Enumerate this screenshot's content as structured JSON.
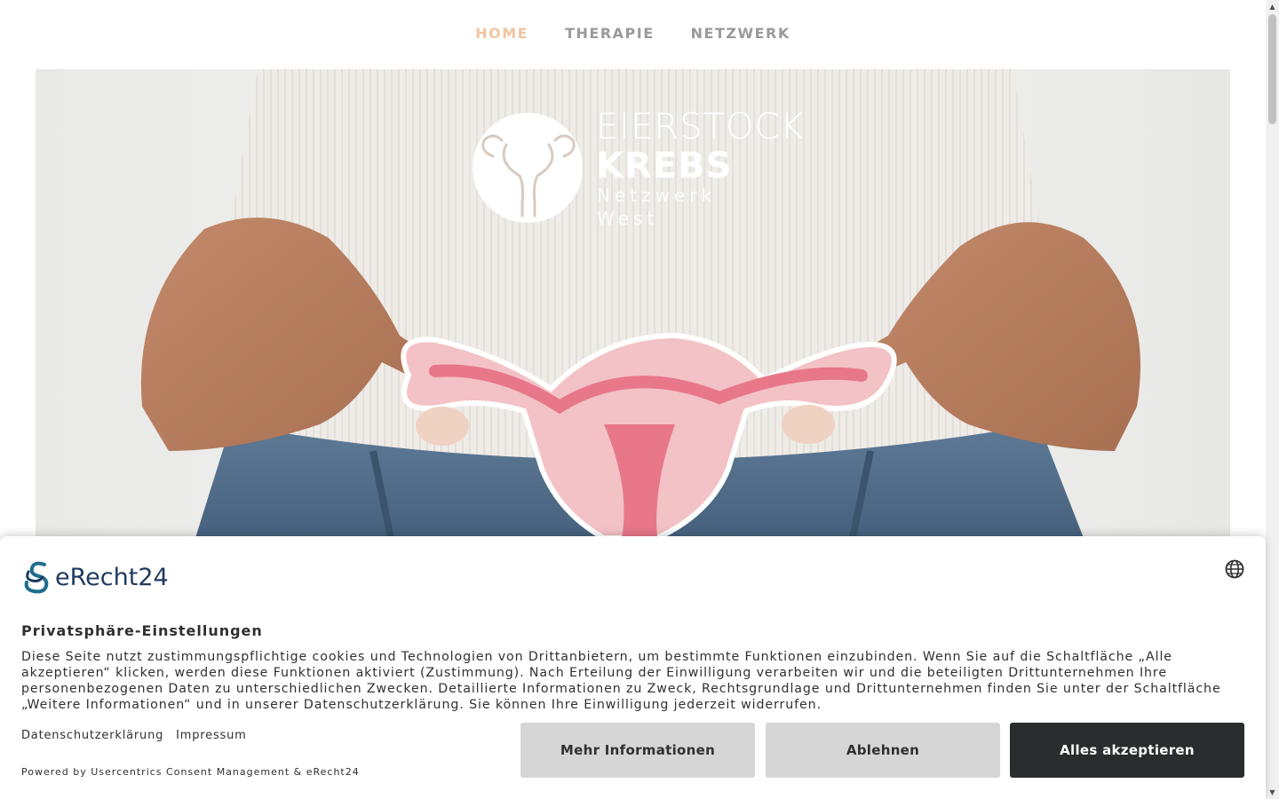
{
  "nav": {
    "items": [
      {
        "label": "HOME",
        "active": true
      },
      {
        "label": "THERAPIE",
        "active": false
      },
      {
        "label": "NETZWERK",
        "active": false
      }
    ],
    "active_color": "#f2c4a0",
    "inactive_color": "#9a9a9a"
  },
  "hero": {
    "logo": {
      "line1": "EIERSTOCK",
      "line2": "KREBS",
      "line3": "Netzwerk",
      "line4": "West"
    }
  },
  "consent": {
    "brand_name": "eRecht24",
    "language_icon": "globe-icon",
    "title": "Privatsphäre-Einstellungen",
    "text": "Diese Seite nutzt zustimmungspflichtige cookies und Technologien von Drittanbietern, um bestimmte Funktionen einzubinden. Wenn Sie auf die Schaltfläche „Alle akzeptieren“ klicken, werden diese Funktionen aktiviert (Zustimmung). Nach Erteilung der Einwilligung verarbeiten wir und die beteiligten Drittunternehmen Ihre personenbezogenen Daten zu unterschiedlichen Zwecken. Detaillierte Informationen zu Zweck, Rechtsgrundlage und Drittunternehmen finden Sie unter der Schaltfläche „Weitere Informationen“ und in unserer Datenschutzerklärung. Sie können Ihre Einwilligung jederzeit widerrufen.",
    "links": {
      "privacy": "Datenschutzerklärung",
      "imprint": "Impressum"
    },
    "powered_by": "Powered by Usercentrics Consent Management & eRecht24",
    "buttons": {
      "more": "Mehr Informationen",
      "deny": "Ablehnen",
      "accept": "Alles akzeptieren"
    },
    "accept_color": "#2b2c2e",
    "secondary_color": "#d6d6d6"
  }
}
